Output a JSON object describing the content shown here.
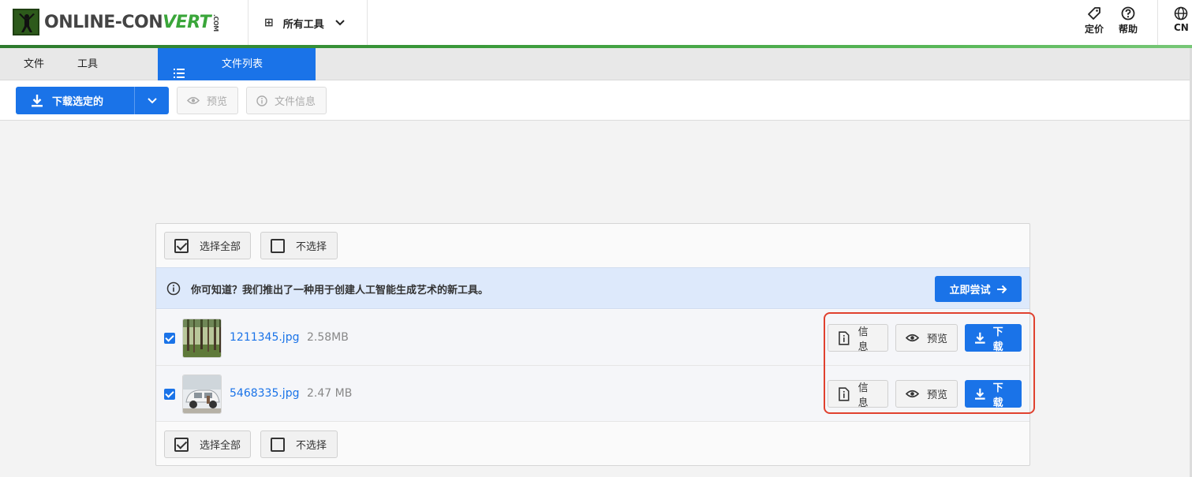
{
  "header": {
    "logo_text_main": "ONLINE-CON",
    "logo_text_accent": "VERT",
    "logo_text_com": ".COM",
    "tools_menu_label": "所有工具",
    "pricing_label": "定价",
    "help_label": "帮助",
    "language_label": "CN"
  },
  "tabs": {
    "file": "文件",
    "tools": "工具",
    "file_list": "文件列表"
  },
  "toolbar": {
    "download_selected": "下载选定的",
    "preview": "预览",
    "file_info": "文件信息"
  },
  "panel": {
    "select_all": "选择全部",
    "select_none": "不选择",
    "notice_text": "你可知道？我们推出了一种用于创建人工智能生成艺术的新工具。",
    "try_now": "立即尝试",
    "files": [
      {
        "name": "1211345.jpg",
        "size": "2.58MB",
        "checked": true,
        "info": "信息",
        "preview": "预览",
        "download": "下载"
      },
      {
        "name": "5468335.jpg",
        "size": "2.47 MB",
        "checked": true,
        "info": "信息",
        "preview": "预览",
        "download": "下载"
      }
    ]
  },
  "colors": {
    "primary": "#1a73e8",
    "brand_green": "#3a9a3a",
    "highlight": "#e0412f",
    "notice_bg": "#dde9fb"
  }
}
